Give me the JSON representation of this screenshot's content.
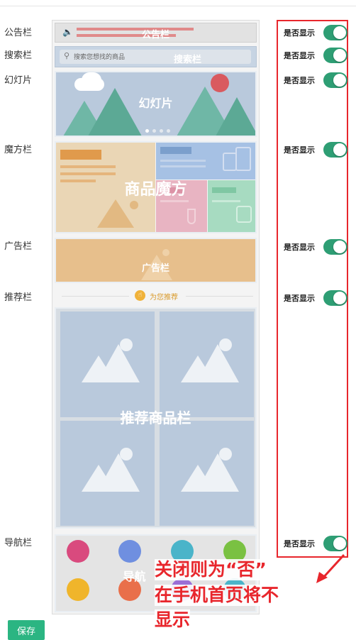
{
  "rows": {
    "notice": "公告栏",
    "search": "搜索栏",
    "slider": "幻灯片",
    "magic": "魔方栏",
    "ad": "广告栏",
    "recommend": "推荐栏",
    "nav": "导航栏"
  },
  "preview": {
    "notice_label": "公告栏",
    "search_placeholder": "搜索您想找的商品",
    "search_label": "搜索栏",
    "slider_label": "幻灯片",
    "magic_label": "商品魔方",
    "ad_label": "广告栏",
    "recommend_header": "为您推荐",
    "recommend_label": "推荐商品栏",
    "nav_label": "导航"
  },
  "toggle_label": "是否显示",
  "annotation": [
    "关闭则为“否”",
    "在手机首页将不",
    "显示"
  ],
  "save_label": "保存",
  "colors": {
    "accent": "#2bb582",
    "toggle_on": "#2e9e74",
    "highlight": "#e8262c"
  }
}
